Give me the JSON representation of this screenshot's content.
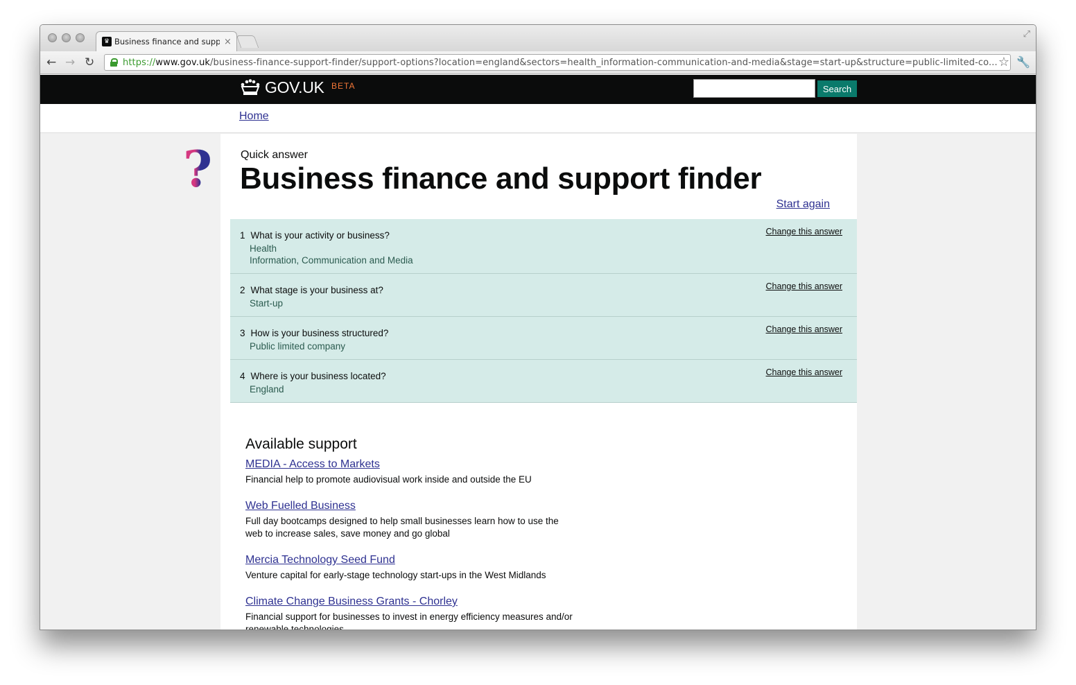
{
  "browser": {
    "tab_title": "Business finance and suppor",
    "url_scheme": "https://",
    "url_host": "www.gov.uk",
    "url_path": "/business-finance-support-finder/support-options?location=england&sectors=health_information-communication-and-media&stage=start-up&structure=public-limited-co..."
  },
  "header": {
    "logo": "GOV.UK",
    "beta": "BETA",
    "search_button": "Search",
    "search_placeholder": ""
  },
  "breadcrumb": {
    "home": "Home"
  },
  "page": {
    "kicker": "Quick answer",
    "title": "Business finance and support finder",
    "start_again": "Start again"
  },
  "answers": [
    {
      "num": "1",
      "question": "What is your activity or business?",
      "values": [
        "Health",
        "Information, Communication and Media"
      ],
      "change": "Change this answer"
    },
    {
      "num": "2",
      "question": "What stage is your business at?",
      "values": [
        "Start-up"
      ],
      "change": "Change this answer"
    },
    {
      "num": "3",
      "question": "How is your business structured?",
      "values": [
        "Public limited company"
      ],
      "change": "Change this answer"
    },
    {
      "num": "4",
      "question": "Where is your business located?",
      "values": [
        "England"
      ],
      "change": "Change this answer"
    }
  ],
  "support": {
    "heading": "Available support",
    "items": [
      {
        "title": "MEDIA - Access to Markets",
        "desc": "Financial help to promote audiovisual work inside and outside the EU"
      },
      {
        "title": "Web Fuelled Business",
        "desc": "Full day bootcamps designed to help small businesses learn how to use the web to increase sales, save money and go global"
      },
      {
        "title": "Mercia Technology Seed Fund",
        "desc": "Venture capital for early-stage technology start-ups in the West Midlands"
      },
      {
        "title": "Climate Change Business Grants - Chorley",
        "desc": "Financial support for businesses to invest in energy efficiency measures and/or renewable technologies"
      }
    ]
  },
  "colors": {
    "header_bg": "#0b0c0c",
    "search_btn": "#0a7a6b",
    "answer_bg": "#d5ebe8",
    "link": "#2e3191",
    "beta": "#f47738"
  }
}
